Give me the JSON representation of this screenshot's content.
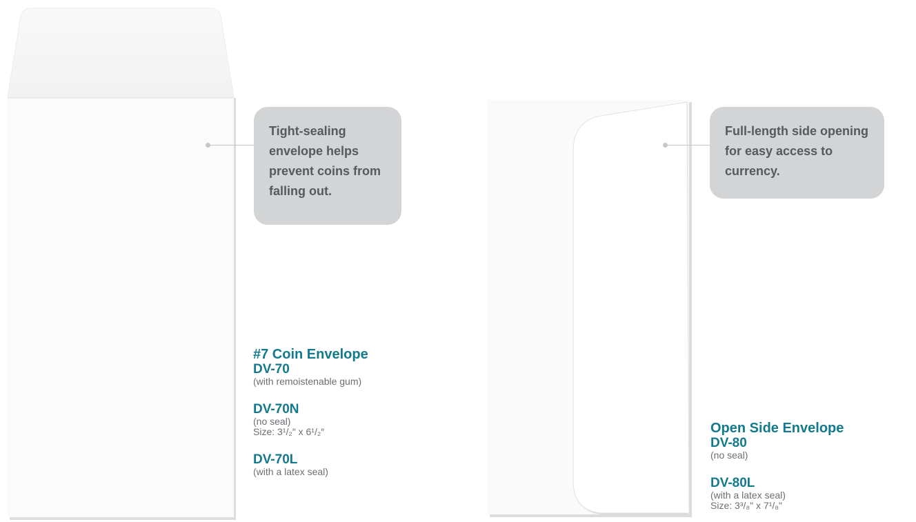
{
  "products": [
    {
      "callout": "Tight-sealing envelope helps prevent coins from falling out.",
      "title": "#7 Coin Envelope",
      "variants": [
        {
          "model": "DV-70",
          "notes": [
            "(with remoistenable gum)"
          ]
        },
        {
          "model": "DV-70N",
          "notes": [
            "(no seal)",
            "Size: 3¹/₂″ x 6¹/₂″"
          ]
        },
        {
          "model": "DV-70L",
          "notes": [
            "(with a latex seal)"
          ]
        }
      ]
    },
    {
      "callout": "Full-length side opening for easy access to currency.",
      "title": "Open Side Envelope",
      "variants": [
        {
          "model": "DV-80",
          "notes": [
            "(no seal)"
          ]
        },
        {
          "model": "DV-80L",
          "notes": [
            "(with a latex seal)",
            "Size: 3³/₈\" x 7¹/₈\""
          ]
        }
      ]
    }
  ],
  "colors": {
    "accent": "#127a8c",
    "callout_bg": "#d3d4d6",
    "callout_text": "#555a5f",
    "note_text": "#6a6e72"
  },
  "icons": [
    "callout-pointer-dot"
  ]
}
